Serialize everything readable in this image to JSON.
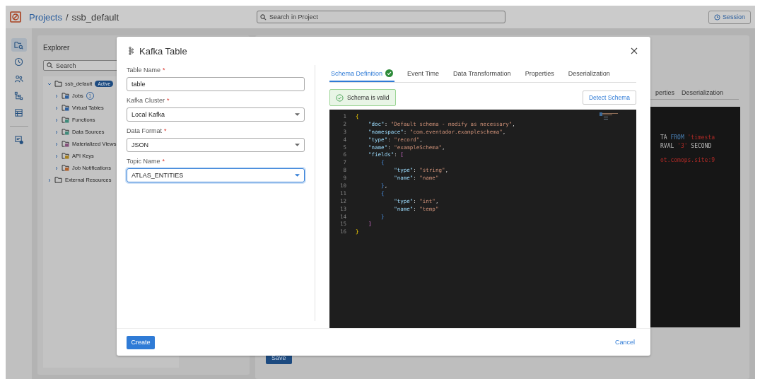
{
  "header": {
    "breadcrumb": [
      "Projects",
      "ssb_default"
    ],
    "separator": "/",
    "search": {
      "placeholder": "Search in Project"
    },
    "session_button": "Session"
  },
  "rail": [
    {
      "kind": "folder",
      "selected": true
    },
    {
      "kind": "clock",
      "selected": false
    },
    {
      "kind": "people",
      "selected": false
    },
    {
      "kind": "tree",
      "selected": false
    },
    {
      "kind": "table",
      "selected": false
    },
    {
      "kind": "monitor",
      "selected": false
    }
  ],
  "explorer": {
    "title": "Explorer",
    "search": {
      "placeholder": "Search"
    },
    "tree": [
      {
        "label": "ssb_default",
        "badge": "Active",
        "expanded": true,
        "children": [
          {
            "label": "Jobs",
            "count": "1",
            "color": "#2c5f9e",
            "expanded": false
          },
          {
            "label": "Virtual Tables",
            "color": "#2c5f9e",
            "expanded": false
          },
          {
            "label": "Functions",
            "color": "#3f8a7a",
            "expanded": false
          },
          {
            "label": "Data Sources",
            "color": "#3f8a7a",
            "expanded": false
          },
          {
            "label": "Materialized Views",
            "color": "#84507a",
            "expanded": false
          },
          {
            "label": "API Keys",
            "color": "#a8801e",
            "expanded": false
          },
          {
            "label": "Job Notifications",
            "color": "#b0602a",
            "expanded": false
          }
        ]
      },
      {
        "label": "External Resources",
        "expanded": false
      }
    ]
  },
  "background_panel": {
    "tabs": [
      "perties",
      "Deserialization"
    ],
    "code_lines": [
      {
        "tokens": [
          {
            "kind": "plain",
            "text": "TA "
          },
          {
            "kind": "keyword",
            "text": "FROM"
          },
          {
            "kind": "string",
            "text": " 'timesta"
          }
        ]
      },
      {
        "tokens": [
          {
            "kind": "plain",
            "text": "RVAL "
          },
          {
            "kind": "string",
            "text": "'3'"
          },
          {
            "kind": "plain",
            "text": " SECOND"
          }
        ]
      },
      {
        "tokens": [
          {
            "kind": "string",
            "text": "ot.comops.site:9"
          }
        ]
      }
    ],
    "save_button": "Save"
  },
  "dialog": {
    "title": "Kafka Table",
    "fields": [
      {
        "label": "Table Name",
        "required_mark": "*",
        "kind": "text",
        "value": "table",
        "focused": false
      },
      {
        "label": "Kafka Cluster",
        "required_mark": "*",
        "kind": "select",
        "value": "Local Kafka",
        "focused": false
      },
      {
        "label": "Data Format",
        "required_mark": "*",
        "kind": "select",
        "value": "JSON",
        "focused": false
      },
      {
        "label": "Topic Name",
        "required_mark": "*",
        "kind": "select",
        "value": "ATLAS_ENTITIES",
        "focused": true
      }
    ],
    "tabs": [
      {
        "label": "Schema Definition",
        "selected": true,
        "valid": true
      },
      {
        "label": "Event Time",
        "selected": false,
        "valid": false
      },
      {
        "label": "Data Transformation",
        "selected": false,
        "valid": false
      },
      {
        "label": "Properties",
        "selected": false,
        "valid": false
      },
      {
        "label": "Deserialization",
        "selected": false,
        "valid": false
      }
    ],
    "status": "Schema is valid",
    "detect_button": "Detect Schema",
    "code_lines": [
      {
        "number": "1",
        "tokens": [
          {
            "kind": "brace",
            "text": "{"
          }
        ]
      },
      {
        "number": "2",
        "tokens": [
          {
            "kind": "key",
            "text": "    \"doc\""
          },
          {
            "kind": "punct",
            "text": ": "
          },
          {
            "kind": "string",
            "text": "\"Default schema - modify as necessary\""
          },
          {
            "kind": "punct",
            "text": ","
          }
        ]
      },
      {
        "number": "3",
        "tokens": [
          {
            "kind": "key",
            "text": "    \"namespace\""
          },
          {
            "kind": "punct",
            "text": ": "
          },
          {
            "kind": "string",
            "text": "\"com.eventador.exampleschema\""
          },
          {
            "kind": "punct",
            "text": ","
          }
        ]
      },
      {
        "number": "4",
        "tokens": [
          {
            "kind": "key",
            "text": "    \"type\""
          },
          {
            "kind": "punct",
            "text": ": "
          },
          {
            "kind": "string",
            "text": "\"record\""
          },
          {
            "kind": "punct",
            "text": ","
          }
        ]
      },
      {
        "number": "5",
        "tokens": [
          {
            "kind": "key",
            "text": "    \"name\""
          },
          {
            "kind": "punct",
            "text": ": "
          },
          {
            "kind": "string",
            "text": "\"exampleSchema\""
          },
          {
            "kind": "punct",
            "text": ","
          }
        ]
      },
      {
        "number": "6",
        "tokens": [
          {
            "kind": "key",
            "text": "    \"fields\""
          },
          {
            "kind": "punct",
            "text": ": "
          },
          {
            "kind": "bracket",
            "text": "["
          }
        ]
      },
      {
        "number": "7",
        "tokens": [
          {
            "kind": "inner",
            "text": "        {"
          }
        ]
      },
      {
        "number": "8",
        "tokens": [
          {
            "kind": "key",
            "text": "            \"type\""
          },
          {
            "kind": "punct",
            "text": ": "
          },
          {
            "kind": "string",
            "text": "\"string\""
          },
          {
            "kind": "punct",
            "text": ","
          }
        ]
      },
      {
        "number": "9",
        "tokens": [
          {
            "kind": "key",
            "text": "            \"name\""
          },
          {
            "kind": "punct",
            "text": ": "
          },
          {
            "kind": "string",
            "text": "\"name\""
          }
        ]
      },
      {
        "number": "10",
        "tokens": [
          {
            "kind": "inner",
            "text": "        }"
          },
          {
            "kind": "punct",
            "text": ","
          }
        ]
      },
      {
        "number": "11",
        "tokens": [
          {
            "kind": "inner",
            "text": "        {"
          }
        ]
      },
      {
        "number": "12",
        "tokens": [
          {
            "kind": "key",
            "text": "            \"type\""
          },
          {
            "kind": "punct",
            "text": ": "
          },
          {
            "kind": "string",
            "text": "\"int\""
          },
          {
            "kind": "punct",
            "text": ","
          }
        ]
      },
      {
        "number": "13",
        "tokens": [
          {
            "kind": "key",
            "text": "            \"name\""
          },
          {
            "kind": "punct",
            "text": ": "
          },
          {
            "kind": "string",
            "text": "\"temp\""
          }
        ]
      },
      {
        "number": "14",
        "tokens": [
          {
            "kind": "inner",
            "text": "        }"
          }
        ]
      },
      {
        "number": "15",
        "tokens": [
          {
            "kind": "bracket",
            "text": "    ]"
          }
        ]
      },
      {
        "number": "16",
        "tokens": [
          {
            "kind": "brace",
            "text": "}"
          }
        ]
      }
    ],
    "create_button": "Create",
    "cancel_button": "Cancel"
  }
}
